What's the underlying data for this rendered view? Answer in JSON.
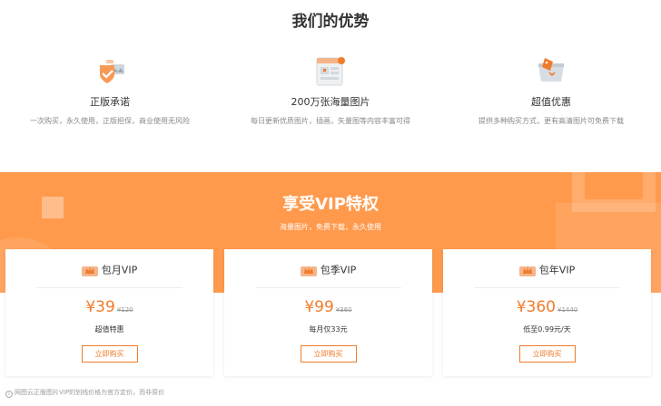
{
  "advantages": {
    "title": "我们的优势",
    "features": [
      {
        "title": "正版承诺",
        "desc": "一次购买，永久使用，正版担保，商业使用无风险",
        "icon": "shield-image-icon"
      },
      {
        "title": "200万张海量图片",
        "desc": "每日更新优质图片，插画，矢量图等内容丰富可得",
        "icon": "gallery-window-icon"
      },
      {
        "title": "超值优惠",
        "desc": "提供多种购买方式，更有高清图片可免费下载",
        "icon": "discount-basket-icon"
      }
    ]
  },
  "vip": {
    "title": "享受VIP特权",
    "subtitle": "海量图片，免费下载，永久使用",
    "plans": [
      {
        "name": "包月VIP",
        "currency": "¥",
        "price": "39",
        "original": "¥120",
        "note": "超值特惠",
        "button": "立即购买",
        "icon": "crown-badge-icon"
      },
      {
        "name": "包季VIP",
        "currency": "¥",
        "price": "99",
        "original": "¥360",
        "note": "每月仅33元",
        "button": "立即购买",
        "icon": "crown-badge-icon"
      },
      {
        "name": "包年VIP",
        "currency": "¥",
        "price": "360",
        "original": "¥1440",
        "note": "低至0.99元/天",
        "button": "立即购买",
        "icon": "crown-badge-icon"
      }
    ]
  },
  "footnote": {
    "icon": "info-icon",
    "text": "网图云正版图片VIP的划线价格为官方定价，而非原价"
  },
  "colors": {
    "accent": "#f07c2a",
    "banner": "#ff9a4d"
  }
}
